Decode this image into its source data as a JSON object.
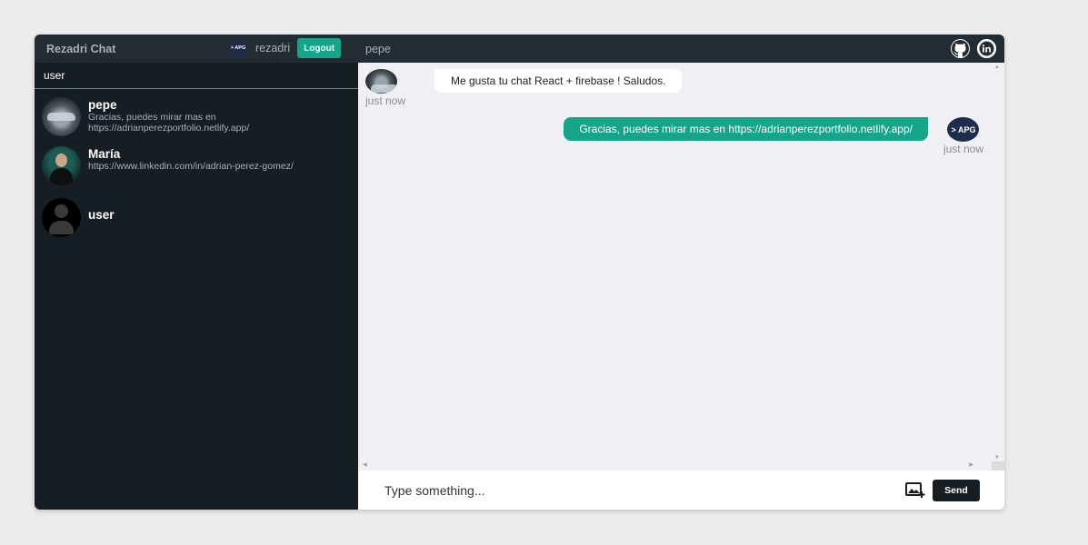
{
  "sidebar": {
    "brand": "Rezadri Chat",
    "user": {
      "avatar_text": "> APG",
      "name": "rezadri"
    },
    "logout_label": "Logout",
    "search": {
      "value": "user",
      "placeholder": ""
    },
    "chats": [
      {
        "name": "pepe",
        "message": "Gracias, puedes mirar mas en https://adrianperezportfolio.netlify.app/",
        "avatar": "car-avatar"
      },
      {
        "name": "María",
        "message": "https://www.linkedin.com/in/adrian-perez-gomez/",
        "avatar": "person-avatar"
      },
      {
        "name": "user",
        "message": "",
        "avatar": "default-avatar"
      }
    ]
  },
  "main": {
    "contact_name": "pepe",
    "icons": [
      "github-icon",
      "linkedin-icon"
    ],
    "messages": [
      {
        "direction": "incoming",
        "text": "Me gusta tu chat React + firebase ! Saludos.",
        "time": "just now"
      },
      {
        "direction": "outgoing",
        "text": "Gracias, puedes mirar mas en https://adrianperezportfolio.netlify.app/",
        "time": "just now",
        "avatar_text": "> APG"
      }
    ],
    "input": {
      "value": "",
      "placeholder": "Type something..."
    },
    "send_label": "Send"
  },
  "colors": {
    "accent": "#17a589",
    "sidebar_bg": "#161d23",
    "navbar_bg": "#232c33",
    "chat_bg": "#f0f0f4",
    "page_bg": "#edecec"
  }
}
